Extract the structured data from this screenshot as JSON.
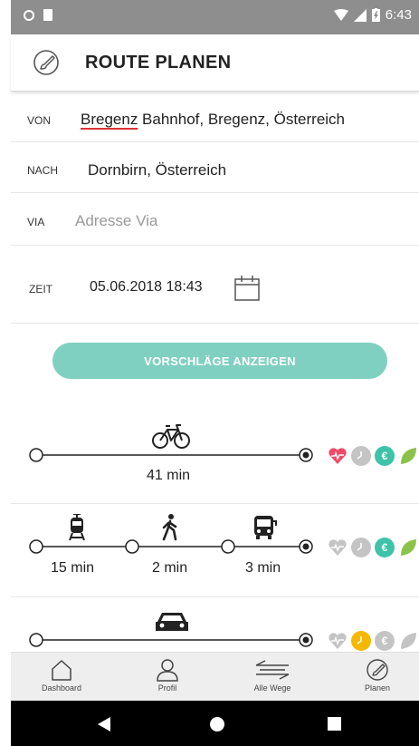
{
  "status_bar": {
    "time": "6:43"
  },
  "app_bar": {
    "title": "ROUTE PLANEN",
    "icon": "brush-icon"
  },
  "form": {
    "from": {
      "label": "VON",
      "value_highlight": "Bregenz",
      "value_rest": " Bahnhof, Bregenz, Österreich"
    },
    "to": {
      "label": "NACH",
      "value": "Dornbirn, Österreich"
    },
    "via": {
      "label": "VIA",
      "placeholder": "Adresse Via"
    },
    "time": {
      "label": "ZEIT",
      "value": "05.06.2018 18:43"
    }
  },
  "cta": {
    "label": "VORSCHLÄGE ANZEIGEN"
  },
  "routes": [
    {
      "mode": "bike",
      "durations": [
        "41 min"
      ]
    },
    {
      "mode": "transit",
      "durations": [
        "15 min",
        "2 min",
        "3 min"
      ]
    },
    {
      "mode": "car",
      "durations": []
    }
  ],
  "badge_colors": {
    "heart_active": "#f04a67",
    "clock_active": "#f5b800",
    "euro_active": "#3ec3a8",
    "leaf_active": "#8bc34a",
    "inactive": "#c4c4c4"
  },
  "bottom_nav": {
    "items": [
      {
        "label": "Dashboard"
      },
      {
        "label": "Profil"
      },
      {
        "label": "Alle Wege"
      },
      {
        "label": "Planen"
      }
    ]
  }
}
